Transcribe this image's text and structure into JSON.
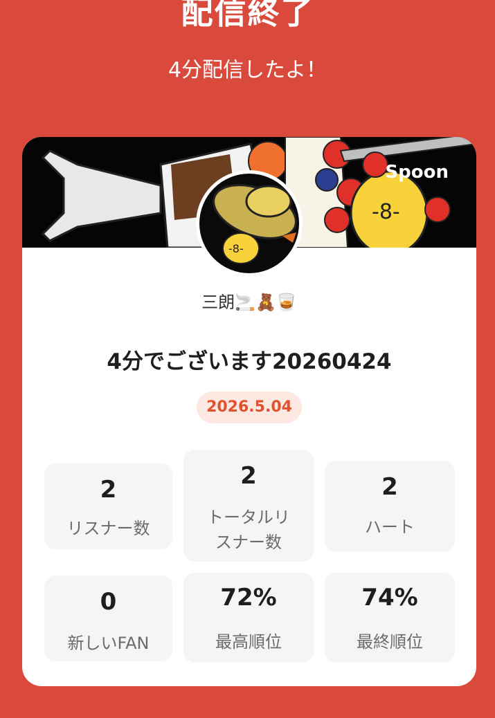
{
  "header": {
    "title": "配信終了",
    "subtitle": "4分配信したよ！"
  },
  "card": {
    "brand": "Spoon",
    "nickname": "三朗🚬🧸🥃",
    "stream_title": "4分でございます20260424",
    "date": "2026.5.04",
    "stats": [
      {
        "value": "2",
        "label": "リスナー数"
      },
      {
        "value": "2",
        "label_line1": "トータルリ",
        "label_line2": "スナー数"
      },
      {
        "value": "2",
        "label": "ハート"
      },
      {
        "value": "0",
        "label": "新しいFAN"
      },
      {
        "value": "72%",
        "label": "最高順位"
      },
      {
        "value": "74%",
        "label": "最終順位"
      }
    ]
  },
  "colors": {
    "background": "#d94a3d",
    "accent": "#e0522d",
    "badge_bg": "#fde8e2"
  }
}
